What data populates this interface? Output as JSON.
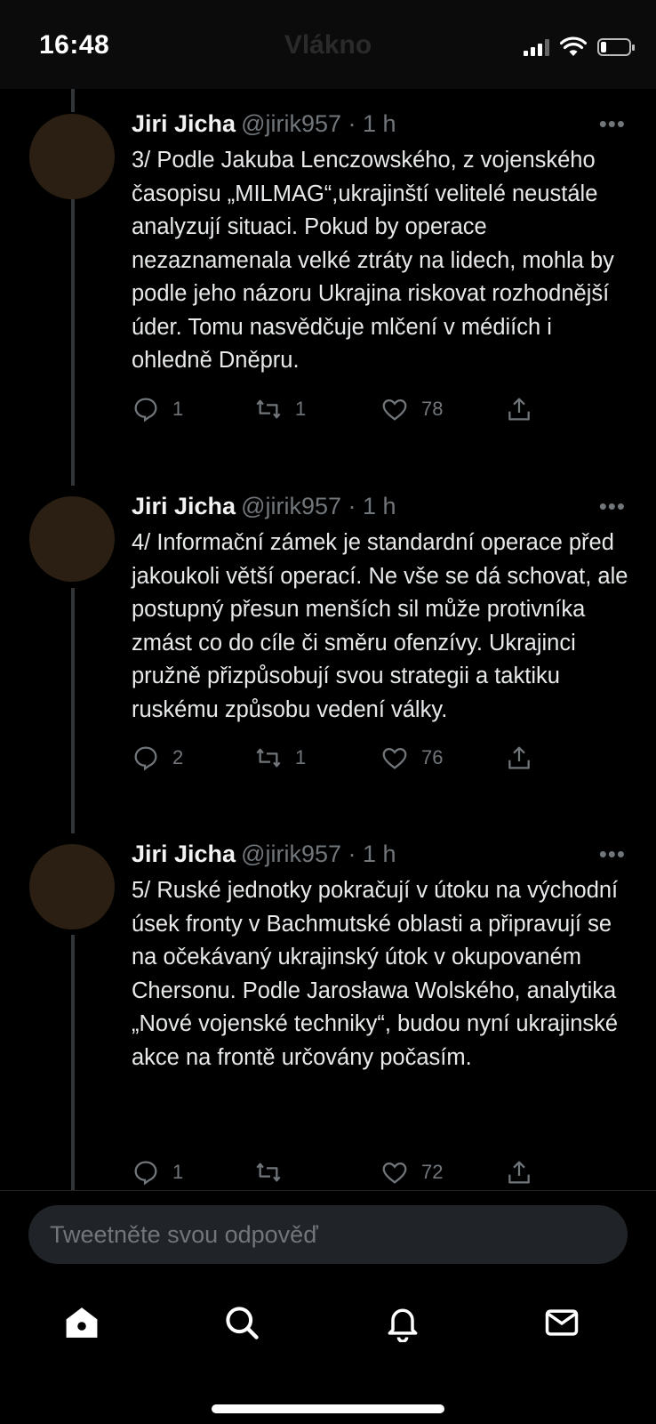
{
  "status_bar": {
    "time": "16:48"
  },
  "header": {
    "title": "Vlákno"
  },
  "tweets": [
    {
      "author": "Jiri Jicha",
      "handle": "@jirik957 · 1 h",
      "text": "3/ Podle Jakuba Lenczowského, z vojenského časopisu „MILMAG“,ukrajinští velitelé neustále analyzují situaci. Pokud by operace nezaznamenala velké ztráty na lidech, mohla by podle jeho názoru Ukrajina riskovat rozhodnější úder. Tomu nasvědčuje  mlčení v médiích i ohledně Dněpru.",
      "replies": "1",
      "retweets": "1",
      "likes": "78"
    },
    {
      "author": "Jiri Jicha",
      "handle": "@jirik957 · 1 h",
      "text": "4/ Informační zámek je standardní operace před jakoukoli větší operací. Ne vše se dá schovat, ale postupný přesun menších sil může protivníka zmást co do cíle či směru ofenzívy. Ukrajinci pružně přizpůsobují svou strategii a taktiku ruskému způsobu vedení války.",
      "replies": "2",
      "retweets": "1",
      "likes": "76"
    },
    {
      "author": "Jiri Jicha",
      "handle": "@jirik957 · 1 h",
      "text": "5/ Ruské jednotky pokračují v útoku na východní úsek fronty v Bachmutské oblasti a připravují se na očekávaný ukrajinský útok v okupovaném Chersonu. Podle Jarosława Wolského, analytika „Nové vojenské techniky“, budou nyní ukrajinské akce na frontě určovány počasím.",
      "replies": "1",
      "retweets": "",
      "likes": "72"
    }
  ],
  "more_glyph": "•••",
  "reply": {
    "placeholder": "Tweetněte svou odpověď"
  },
  "tabbar": {
    "icons": [
      "home-icon",
      "search-icon",
      "bell-icon",
      "mail-icon"
    ]
  },
  "battery_level": 0.2,
  "colors": {
    "background": "#000000",
    "text": "#e7e9ea",
    "muted": "#71767b",
    "input_bg": "#202327"
  }
}
